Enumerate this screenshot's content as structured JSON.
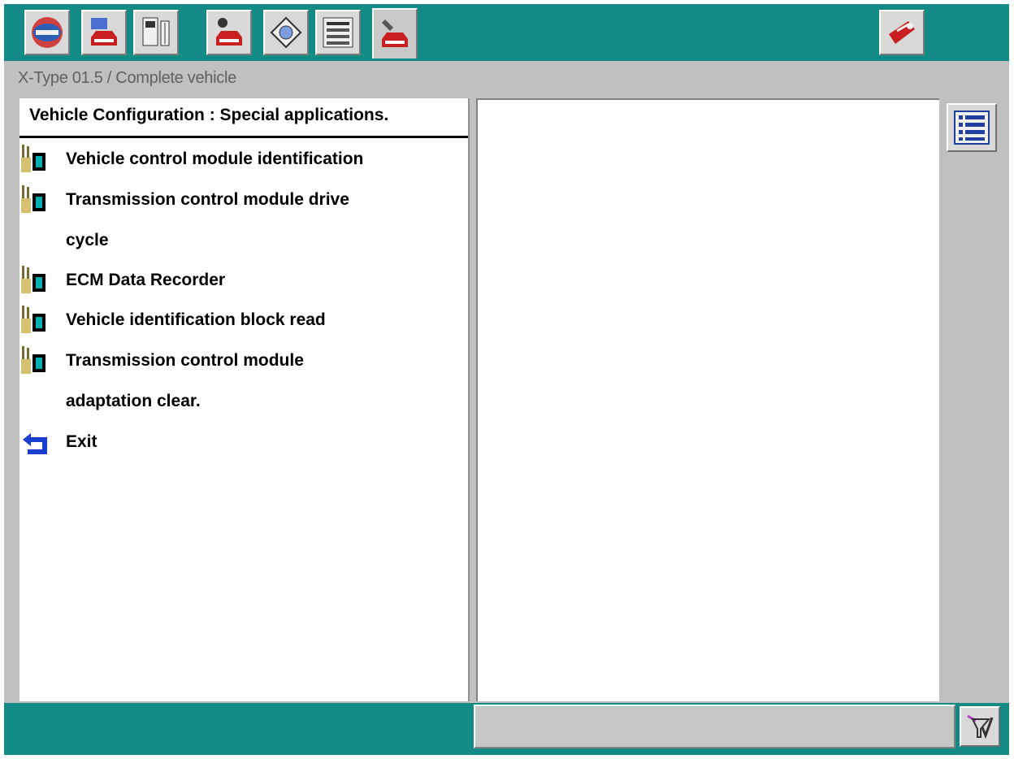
{
  "breadcrumb": "X-Type 01.5 / Complete vehicle",
  "panel_title": "Vehicle Configuration : Special applications.",
  "menu": [
    {
      "icon": "tool-module-icon",
      "lines": [
        "Vehicle control module identification"
      ]
    },
    {
      "icon": "tool-module-icon",
      "lines": [
        "Transmission control module drive",
        "cycle"
      ]
    },
    {
      "icon": "tool-module-icon",
      "lines": [
        "ECM Data Recorder"
      ]
    },
    {
      "icon": "tool-module-icon",
      "lines": [
        "Vehicle identification block read"
      ]
    },
    {
      "icon": "tool-module-icon",
      "lines": [
        "Transmission control module",
        "adaptation clear."
      ]
    },
    {
      "icon": "exit-arrow-icon",
      "lines": [
        "Exit"
      ]
    }
  ],
  "toolbar": {
    "tabs": [
      "home-logo-icon",
      "vehicle-info-icon",
      "module-config-icon",
      "diagnostics-car-icon",
      "disc-icon",
      "data-list-icon",
      "special-apps-car-icon"
    ],
    "active_tab": 6,
    "right_icon": "toolbox-icon"
  },
  "colors": {
    "accent": "#138a86",
    "panel": "#c0c0c0"
  }
}
